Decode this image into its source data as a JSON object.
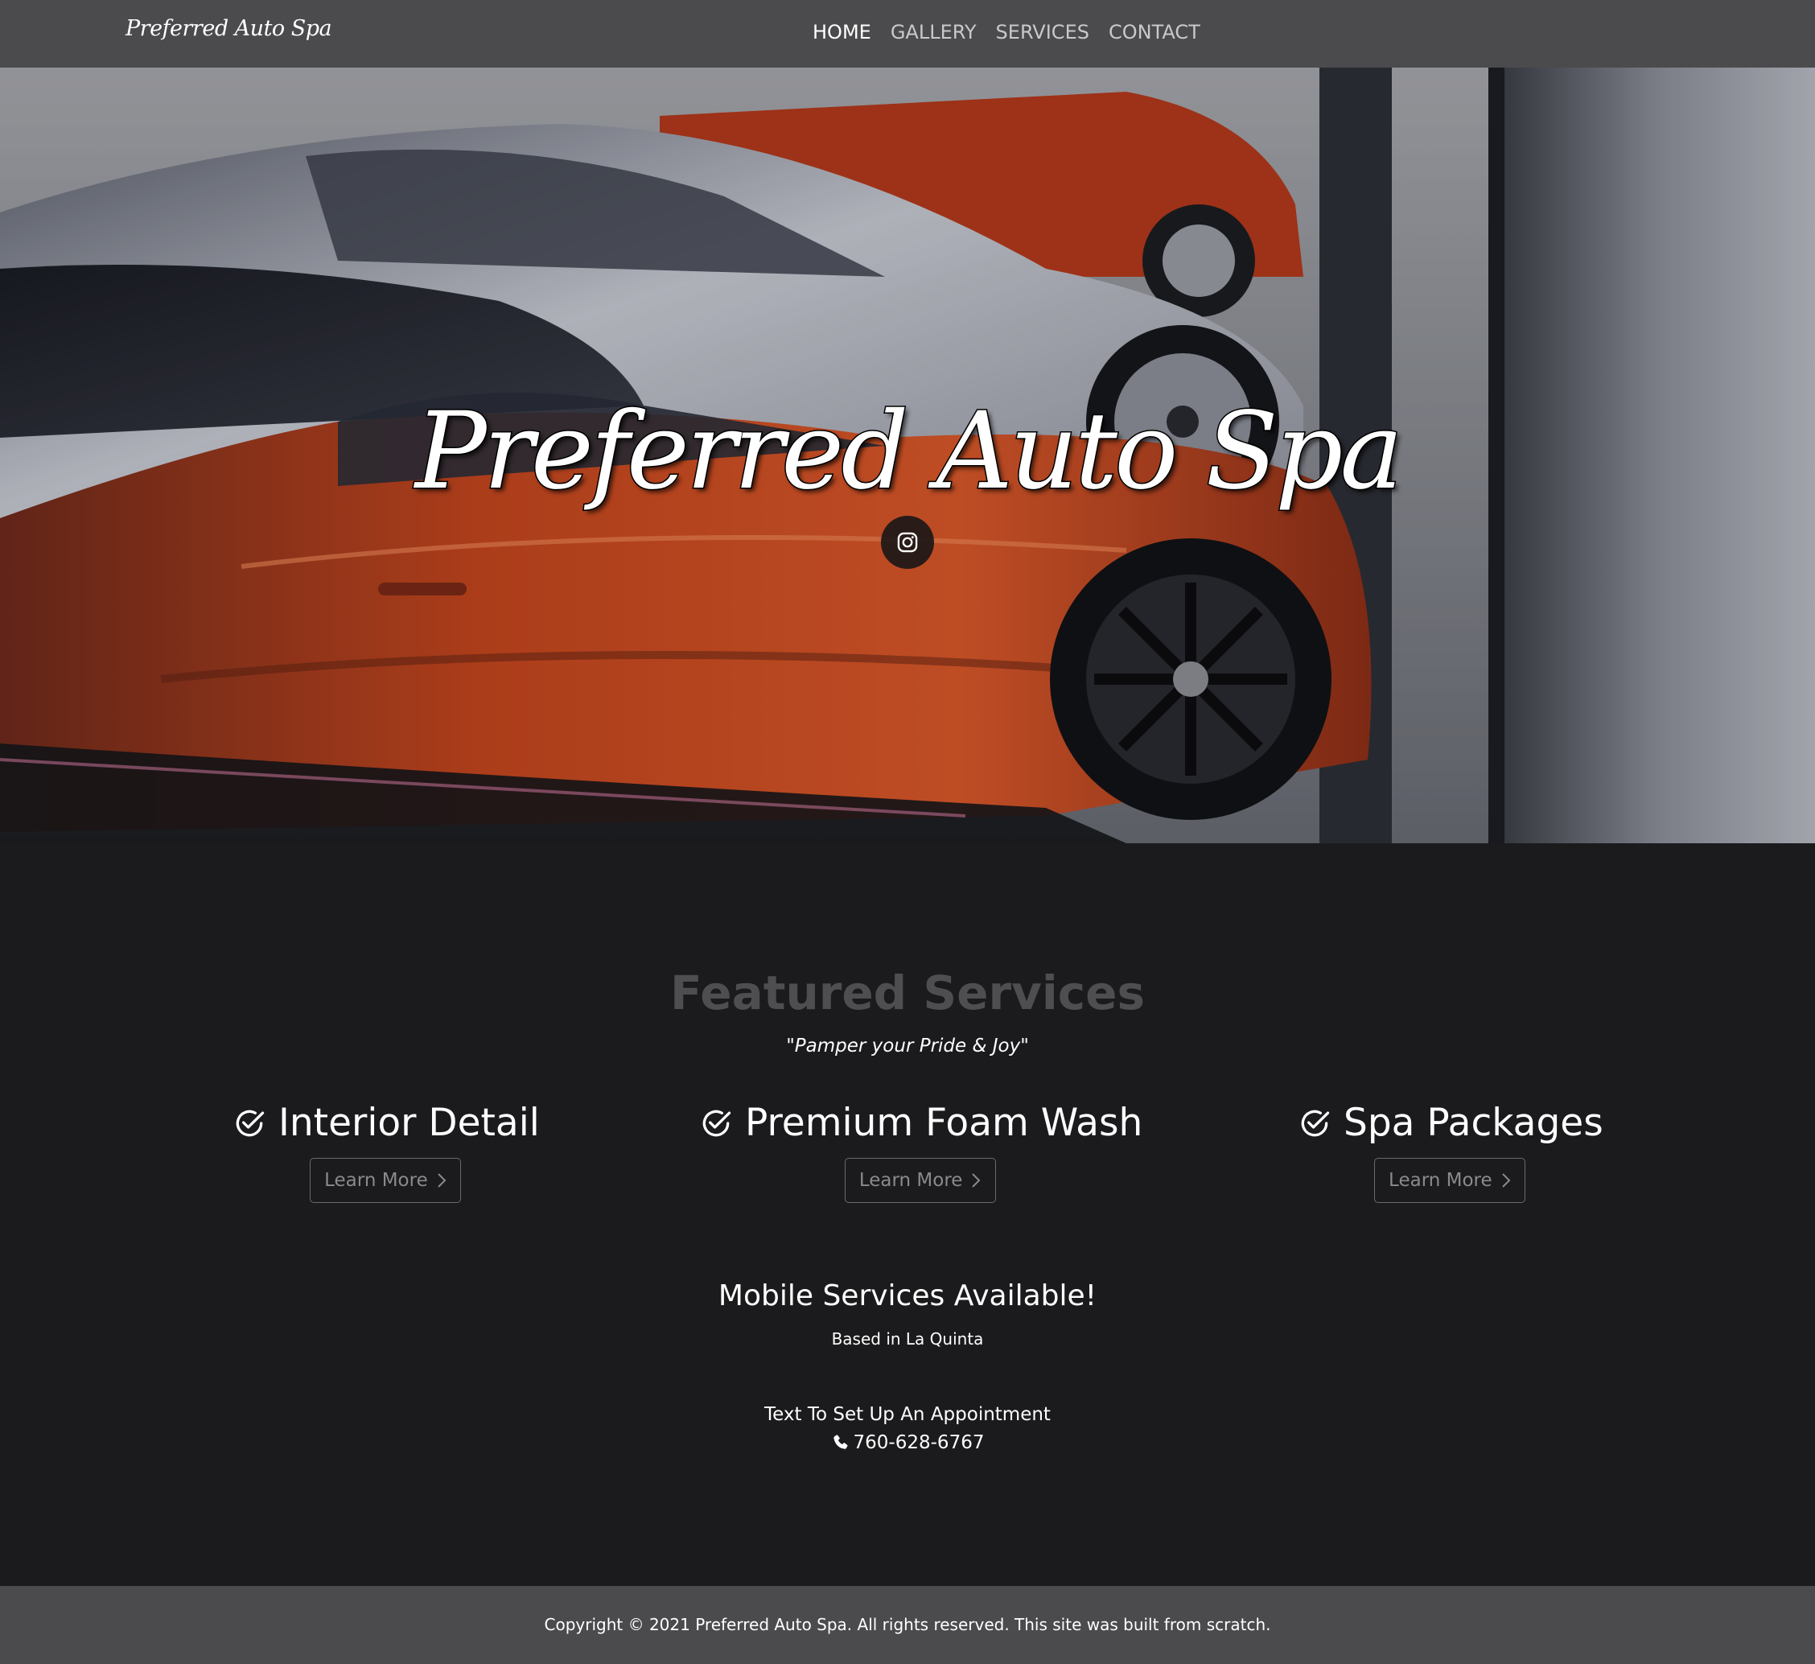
{
  "navbar": {
    "brand": "Preferred Auto Spa",
    "links": [
      "HOME",
      "GALLERY",
      "SERVICES",
      "CONTACT"
    ],
    "active": "HOME"
  },
  "hero": {
    "title": "Preferred Auto Spa",
    "social_icon": "instagram-icon"
  },
  "featured": {
    "title": "Featured Services",
    "tagline": "\"Pamper your Pride & Joy\"",
    "services": [
      {
        "name": "Interior Detail",
        "icon": "check-circle-icon",
        "button": "Learn More"
      },
      {
        "name": "Premium Foam Wash",
        "icon": "check-circle-icon",
        "button": "Learn More"
      },
      {
        "name": "Spa Packages",
        "icon": "check-circle-icon",
        "button": "Learn More"
      }
    ]
  },
  "mobile": {
    "title": "Mobile Services Available!",
    "location": "Based in La Quinta",
    "cta": "Text To Set Up An Appointment",
    "phone": "760-628-6767",
    "phone_icon": "phone-icon"
  },
  "footer": {
    "copyright": "Copyright © 2021 Preferred Auto Spa. All rights reserved. This site was built from scratch."
  },
  "colors": {
    "nav_bg": "#4b4b4d",
    "page_bg": "#1b1b1d",
    "section_title": "#4e4e50",
    "car_orange": "#c4461e"
  }
}
